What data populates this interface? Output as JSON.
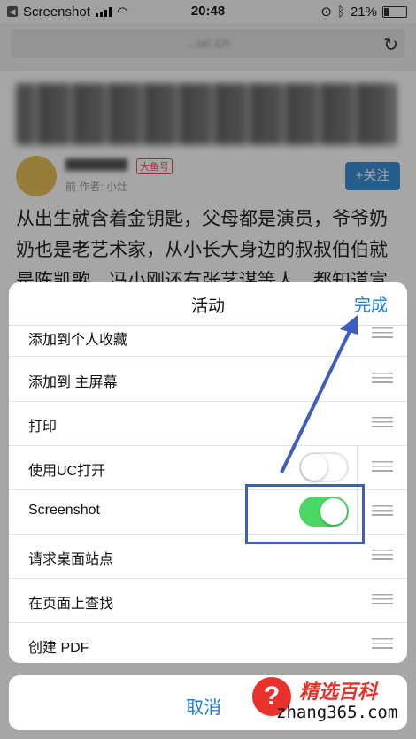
{
  "status_bar": {
    "back_label": "Screenshot",
    "time": "20:48",
    "battery": "21%"
  },
  "url_bar": {
    "url": "...uc.cn"
  },
  "article": {
    "badge": "大鱼号",
    "meta": "前 作者: 小灶",
    "follow": "+关注",
    "body": "从出生就含着金钥匙，父母都是演员，爷爷奶奶也是老艺术家，从小长大身边的叔叔伯伯就是陈凯歌、冯小刚还有张艺谋等人，都知道宣城中"
  },
  "sheet": {
    "title": "活动",
    "done": "完成",
    "rows": [
      {
        "label": "添加到个人收藏"
      },
      {
        "label": "添加到 主屏幕"
      },
      {
        "label": "打印"
      },
      {
        "label": "使用UC打开",
        "toggle": "off"
      },
      {
        "label": "Screenshot",
        "toggle": "on"
      },
      {
        "label": "请求桌面站点"
      },
      {
        "label": "在页面上查找"
      },
      {
        "label": "创建 PDF"
      }
    ]
  },
  "cancel": "取消",
  "watermark": {
    "icon": "?",
    "title": "精选百科",
    "url": "zhang365.com"
  },
  "colors": {
    "accent": "#1a7de0",
    "toggle_on": "#4bd763",
    "highlight": "#3c5fbf"
  }
}
